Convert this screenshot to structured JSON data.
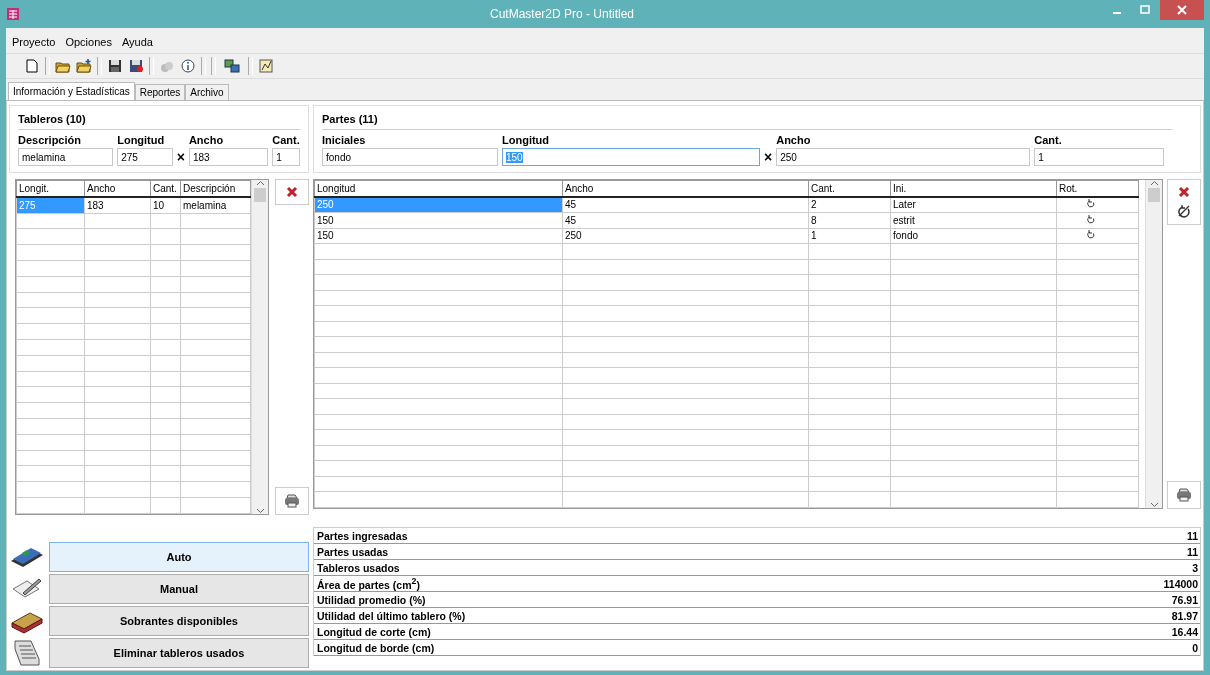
{
  "window": {
    "title": "CutMaster2D Pro - Untitled"
  },
  "menu": [
    "Proyecto",
    "Opciones",
    "Ayuda"
  ],
  "tabs": [
    {
      "label": "Información y Estadísticas",
      "selected": true
    },
    {
      "label": "Reportes",
      "selected": false
    },
    {
      "label": "Archivo",
      "selected": false
    }
  ],
  "boards": {
    "title": "Tableros (10)",
    "times_sign": "×",
    "fields": [
      {
        "label": "Descripción",
        "value": "melamina",
        "focused": false
      },
      {
        "label": "Longitud",
        "value": "275",
        "focused": false
      },
      {
        "label": "Ancho",
        "value": "183",
        "focused": false
      },
      {
        "label": "Cant.",
        "value": "1",
        "focused": false
      }
    ],
    "columns": [
      "Longit.",
      "Ancho",
      "Cant.",
      "Descripción"
    ],
    "rows": [
      {
        "cells": [
          "275",
          "183",
          "10",
          "melamina"
        ],
        "selected": true
      }
    ]
  },
  "parts": {
    "title": "Partes (11)",
    "times_sign": "×",
    "fields": [
      {
        "label": "Iniciales",
        "value": "fondo",
        "focused": false
      },
      {
        "label": "Longitud",
        "value": "150",
        "focused": true
      },
      {
        "label": "Ancho",
        "value": "250",
        "focused": false
      },
      {
        "label": "Cant.",
        "value": "1",
        "focused": false
      }
    ],
    "columns": [
      "Longitud",
      "Ancho",
      "Cant.",
      "Ini.",
      "Rot."
    ],
    "rows": [
      {
        "cells": [
          "250",
          "45",
          "2",
          " Later"
        ],
        "selected": true
      },
      {
        "cells": [
          "150",
          "45",
          "8",
          "estrit"
        ],
        "selected": false
      },
      {
        "cells": [
          "150",
          "250",
          "1",
          "fondo"
        ],
        "selected": false
      }
    ]
  },
  "stats": [
    {
      "label": "Partes ingresadas",
      "value": "11"
    },
    {
      "label": "Partes usadas",
      "value": "11"
    },
    {
      "label": "Tableros usados",
      "value": "3"
    },
    {
      "label": "Área de partes (cm$^{2}$)",
      "value": "114000"
    },
    {
      "label": "Utilidad promedio (%)",
      "value": "76.91"
    },
    {
      "label": "Utilidad del último tablero (%)",
      "value": "81.97"
    },
    {
      "label": "Longitud de corte (cm)",
      "value": "16.44"
    },
    {
      "label": "Longitud de borde (cm)",
      "value": "0"
    }
  ],
  "actions": [
    {
      "label": "Auto",
      "kind": "board",
      "default": true
    },
    {
      "label": "Manual",
      "kind": "pencil",
      "default": false
    },
    {
      "label": "Sobrantes disponibles",
      "kind": "book",
      "default": false
    },
    {
      "label": "Eliminar tableros usados",
      "kind": "list",
      "default": false
    }
  ]
}
